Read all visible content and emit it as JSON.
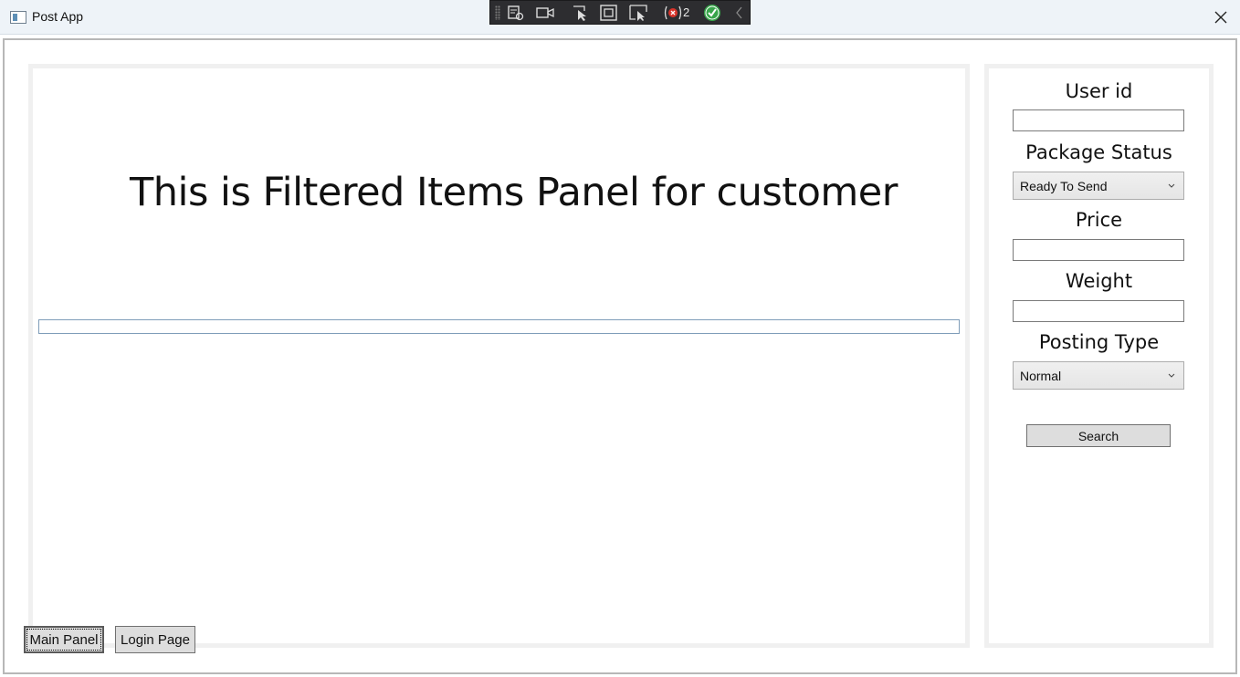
{
  "window": {
    "title": "Post App"
  },
  "debug_toolbar": {
    "error_count": "2"
  },
  "main": {
    "heading": "This is Filtered Items Panel for customer"
  },
  "filters": {
    "user_id_label": "User id",
    "user_id_value": "",
    "package_status_label": "Package Status",
    "package_status_value": "Ready To Send",
    "price_label": "Price",
    "price_value": "",
    "weight_label": "Weight",
    "weight_value": "",
    "posting_type_label": "Posting Type",
    "posting_type_value": "Normal",
    "search_label": "Search"
  },
  "nav": {
    "main_panel_label": "Main Panel",
    "login_page_label": "Login Page"
  }
}
